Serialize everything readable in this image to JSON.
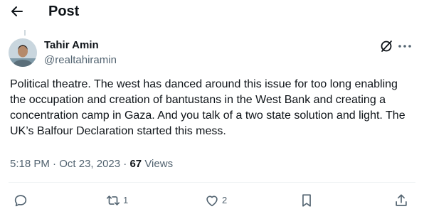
{
  "header": {
    "title": "Post",
    "back_icon": "arrow-left-icon"
  },
  "tweet": {
    "author": {
      "name": "Tahir Amin",
      "handle": "@realtahiramin"
    },
    "text": "Political theatre. The west has danced around this issue for too long enabling the occupation and creation of bantustans in the West Bank and creating a concentration camp in Gaza. And you talk of a two state solution and light. The UK’s Balfour Declaration started this mess.",
    "time": "5:18 PM",
    "separator": "·",
    "date": "Oct 23, 2023",
    "views_count": "67",
    "views_label": "Views"
  },
  "actions": {
    "reply": {
      "icon": "reply-icon",
      "count": ""
    },
    "repost": {
      "icon": "repost-icon",
      "count": "1"
    },
    "like": {
      "icon": "heart-icon",
      "count": "2"
    },
    "bookmark": {
      "icon": "bookmark-icon"
    },
    "share": {
      "icon": "share-icon"
    }
  },
  "colors": {
    "text": "#0f1419",
    "secondary": "#536471",
    "divider": "#eff3f4"
  }
}
